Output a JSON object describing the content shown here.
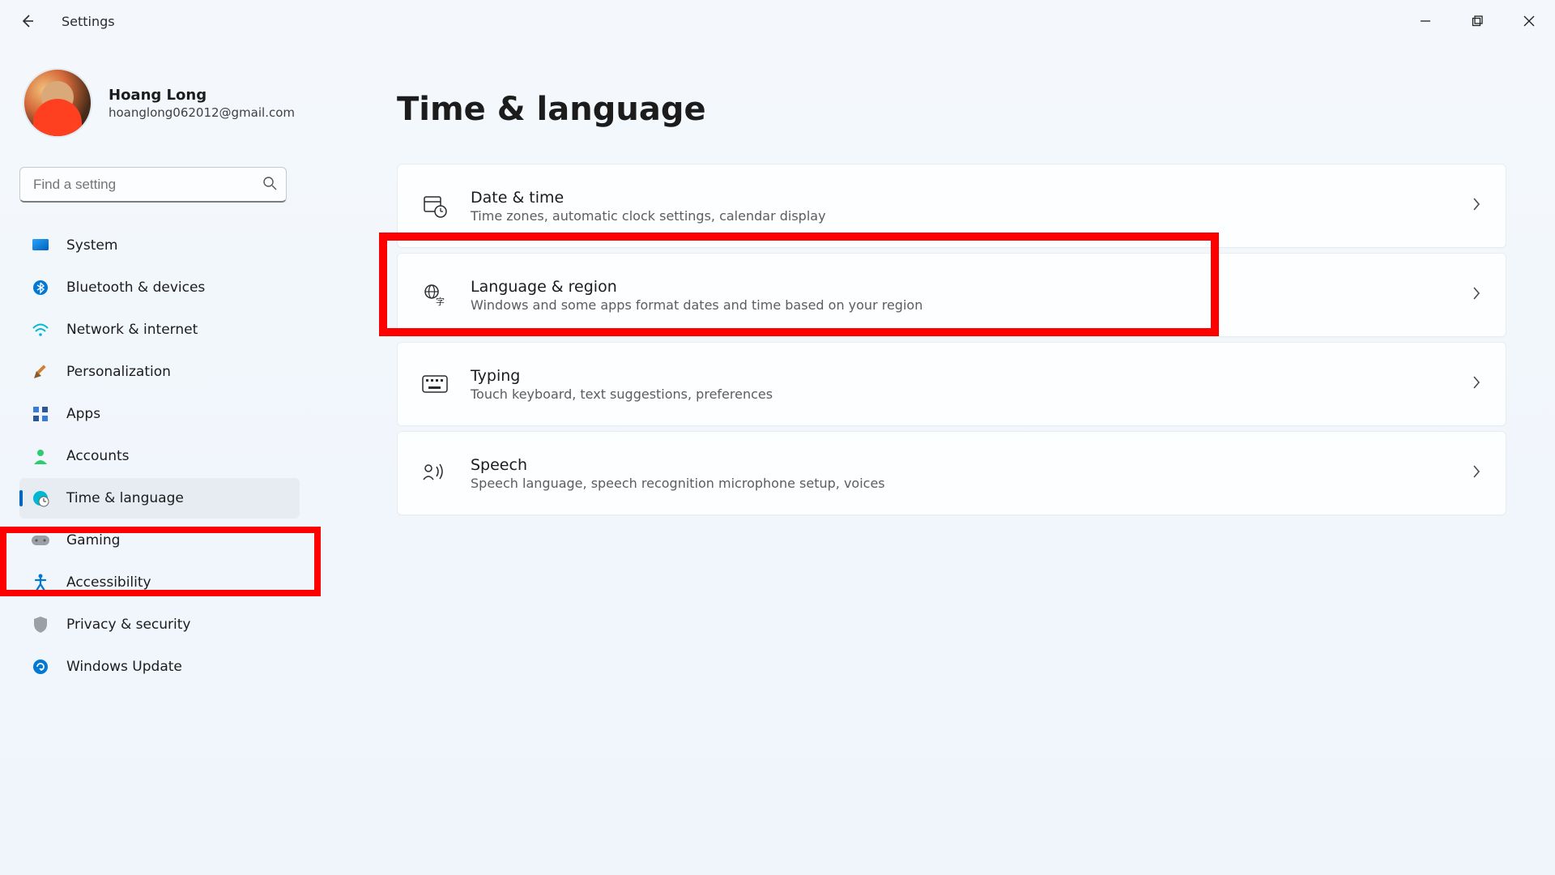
{
  "app": {
    "title": "Settings"
  },
  "profile": {
    "name": "Hoang Long",
    "email": "hoanglong062012@gmail.com"
  },
  "search": {
    "placeholder": "Find a setting"
  },
  "sidebar": {
    "items": [
      {
        "label": "System",
        "icon": "system-icon"
      },
      {
        "label": "Bluetooth & devices",
        "icon": "bluetooth-icon"
      },
      {
        "label": "Network & internet",
        "icon": "wifi-icon"
      },
      {
        "label": "Personalization",
        "icon": "personalization-icon"
      },
      {
        "label": "Apps",
        "icon": "apps-icon"
      },
      {
        "label": "Accounts",
        "icon": "accounts-icon"
      },
      {
        "label": "Time & language",
        "icon": "time-language-icon",
        "active": true
      },
      {
        "label": "Gaming",
        "icon": "gaming-icon"
      },
      {
        "label": "Accessibility",
        "icon": "accessibility-icon"
      },
      {
        "label": "Privacy & security",
        "icon": "privacy-icon"
      },
      {
        "label": "Windows Update",
        "icon": "update-icon"
      }
    ]
  },
  "page": {
    "title": "Time & language",
    "cards": [
      {
        "title": "Date & time",
        "sub": "Time zones, automatic clock settings, calendar display",
        "icon": "date-time-icon"
      },
      {
        "title": "Language & region",
        "sub": "Windows and some apps format dates and time based on your region",
        "icon": "language-region-icon"
      },
      {
        "title": "Typing",
        "sub": "Touch keyboard, text suggestions, preferences",
        "icon": "typing-icon"
      },
      {
        "title": "Speech",
        "sub": "Speech language, speech recognition microphone setup, voices",
        "icon": "speech-icon"
      }
    ]
  }
}
